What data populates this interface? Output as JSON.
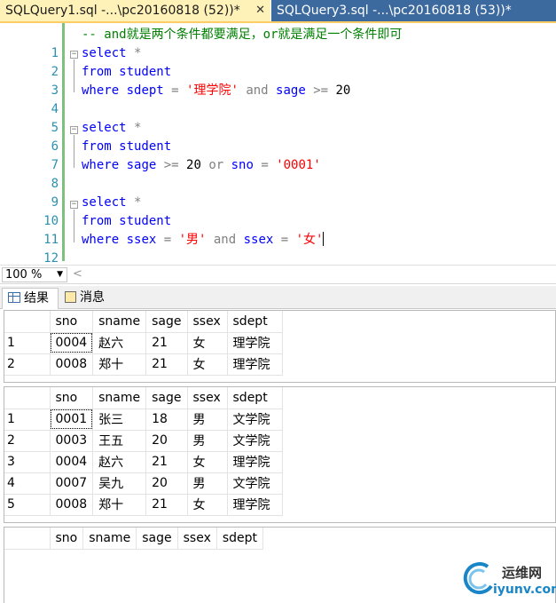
{
  "tabs": {
    "active": "SQLQuery1.sql -...\\pc20160818 (52))*",
    "inactive": "SQLQuery3.sql -...\\pc20160818 (53))*",
    "close_glyph": "✕"
  },
  "editor": {
    "lines": [
      {
        "n": "1"
      },
      {
        "n": "2"
      },
      {
        "n": "3"
      },
      {
        "n": "4"
      },
      {
        "n": "5"
      },
      {
        "n": "6"
      },
      {
        "n": "7"
      },
      {
        "n": "8"
      },
      {
        "n": "9"
      },
      {
        "n": "10"
      },
      {
        "n": "11"
      },
      {
        "n": "12"
      }
    ],
    "code": {
      "l1": "-- and就是两个条件都要满足，or就是满足一个条件即可",
      "select": "select",
      "star": " *",
      "from": "from",
      "student": " student",
      "where": "where",
      "sdept": " sdept ",
      "eq": "= ",
      "v_lixue": "'理学院'",
      "and": " and",
      "sage": " sage ",
      "ge": ">= ",
      "twenty": "20",
      "or": " or",
      "sno": " sno ",
      "v_0001": "'0001'",
      "ssex": " ssex ",
      "v_nan": "'男'",
      "v_nv": "'女'"
    }
  },
  "zoom": {
    "value": "100 %"
  },
  "result_tabs": {
    "results": "结果",
    "messages": "消息"
  },
  "grids": {
    "columns": [
      "sno",
      "sname",
      "sage",
      "ssex",
      "sdept"
    ],
    "grid1": [
      [
        "1",
        "0004",
        "赵六",
        "21",
        "女",
        "理学院"
      ],
      [
        "2",
        "0008",
        "郑十",
        "21",
        "女",
        "理学院"
      ]
    ],
    "grid2": [
      [
        "1",
        "0001",
        "张三",
        "18",
        "男",
        "文学院"
      ],
      [
        "2",
        "0003",
        "王五",
        "20",
        "男",
        "文学院"
      ],
      [
        "3",
        "0004",
        "赵六",
        "21",
        "女",
        "理学院"
      ],
      [
        "4",
        "0007",
        "吴九",
        "20",
        "男",
        "文学院"
      ],
      [
        "5",
        "0008",
        "郑十",
        "21",
        "女",
        "理学院"
      ]
    ]
  },
  "watermark": {
    "line1": "运维网",
    "line2": "iyunv.com"
  }
}
